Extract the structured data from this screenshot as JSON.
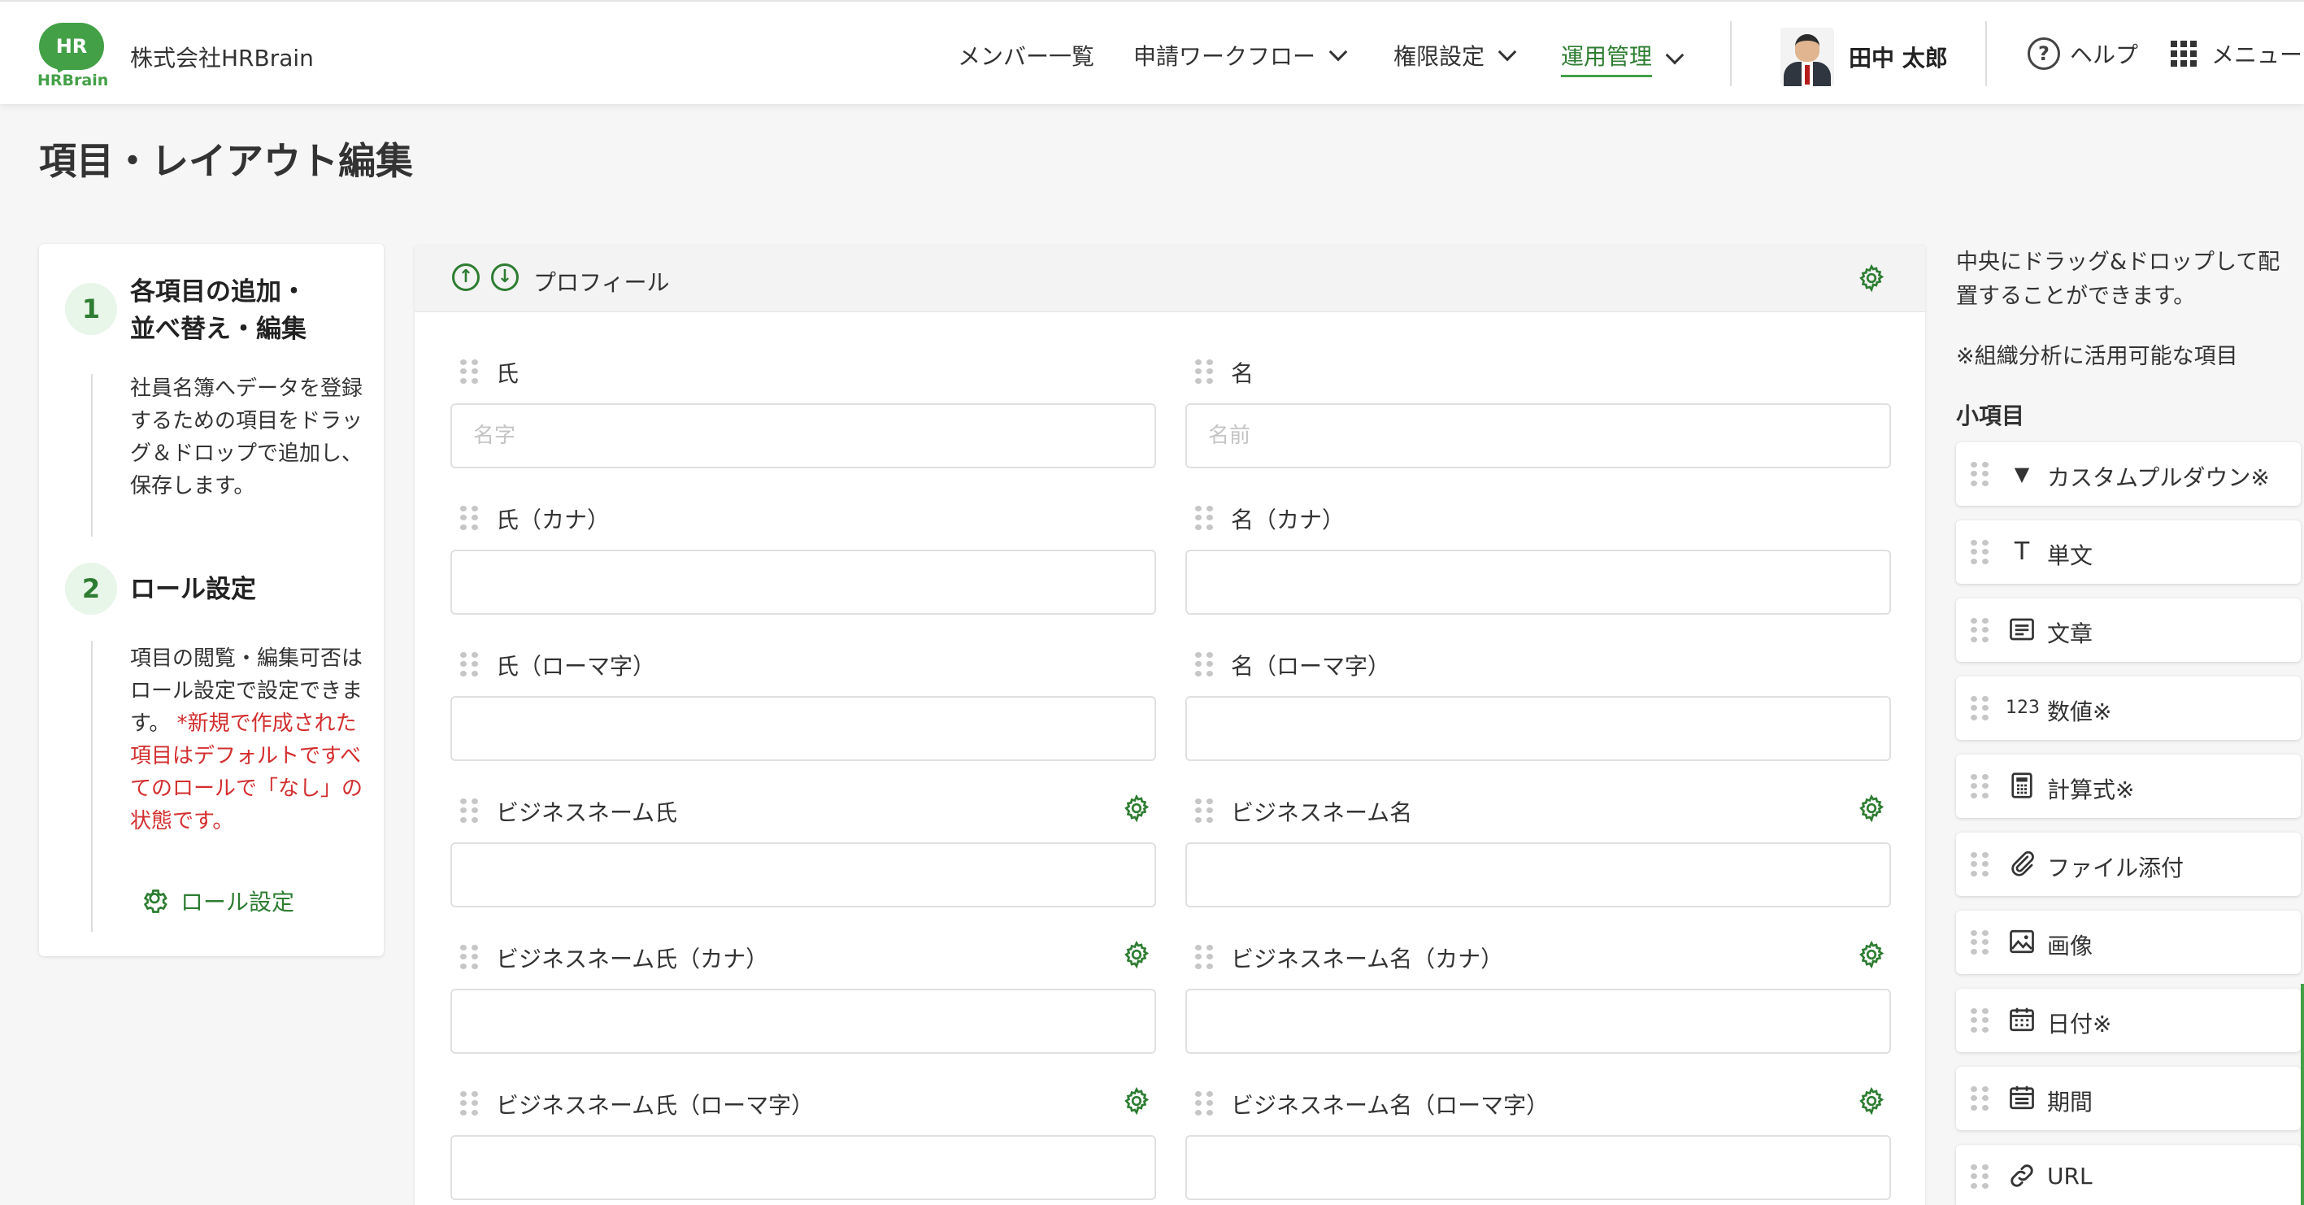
{
  "header": {
    "logo_text": "HR",
    "logo_brand": "HRBrain",
    "company": "株式会社HRBrain",
    "nav": [
      {
        "label": "メンバー一覧"
      },
      {
        "label": "申請ワークフロー"
      },
      {
        "label": "権限設定"
      },
      {
        "label": "運用管理"
      }
    ],
    "user_name": "田中 太郎",
    "help_label": "ヘルプ",
    "menu_label": "メニュー"
  },
  "page": {
    "title": "項目・レイアウト編集"
  },
  "steps": [
    {
      "num": "1",
      "title": "各項目の追加・並べ替え・編集",
      "text": "社員名簿へデータを登録するための項目をドラッグ＆ドロップで追加し、保存します。"
    },
    {
      "num": "2",
      "title": "ロール設定",
      "text": "項目の閲覧・編集可否はロール設定で設定できます。",
      "warning": "*新規で作成された項目はデフォルトですべてのロールで「なし」の状態です。",
      "link": "ロール設定"
    }
  ],
  "form": {
    "section_title": "プロフィール",
    "fields": [
      {
        "label": "氏",
        "placeholder": "名字"
      },
      {
        "label": "名",
        "placeholder": "名前"
      },
      {
        "label": "氏（カナ）",
        "placeholder": ""
      },
      {
        "label": "名（カナ）",
        "placeholder": ""
      },
      {
        "label": "氏（ローマ字）",
        "placeholder": ""
      },
      {
        "label": "名（ローマ字）",
        "placeholder": ""
      },
      {
        "label": "ビジネスネーム氏",
        "placeholder": ""
      },
      {
        "label": "ビジネスネーム名",
        "placeholder": ""
      },
      {
        "label": "ビジネスネーム氏（カナ）",
        "placeholder": ""
      },
      {
        "label": "ビジネスネーム名（カナ）",
        "placeholder": ""
      },
      {
        "label": "ビジネスネーム氏（ローマ字）",
        "placeholder": ""
      },
      {
        "label": "ビジネスネーム名（ローマ字）",
        "placeholder": ""
      }
    ]
  },
  "palette": {
    "intro": "中央にドラッグ&ドロップして配置することができます。",
    "note": "※組織分析に活用可能な項目",
    "subheading": "小項目",
    "items": [
      {
        "icon": "dropdown-triangle-icon",
        "glyph": "▼",
        "label": "カスタムプルダウン※"
      },
      {
        "icon": "text-t-icon",
        "glyph": "T",
        "label": "単文"
      },
      {
        "icon": "paragraph-icon",
        "glyph": "≣",
        "label": "文章"
      },
      {
        "icon": "number-123-icon",
        "glyph": "123",
        "label": "数値※"
      },
      {
        "icon": "calculator-icon",
        "glyph": "▦",
        "label": "計算式※"
      },
      {
        "icon": "paperclip-icon",
        "glyph": "⌇",
        "label": "ファイル添付"
      },
      {
        "icon": "image-icon",
        "glyph": "▨",
        "label": "画像"
      },
      {
        "icon": "calendar-icon",
        "glyph": "▦",
        "label": "日付※"
      },
      {
        "icon": "calendar-range-icon",
        "glyph": "▤",
        "label": "期間"
      },
      {
        "icon": "link-icon",
        "glyph": "⛓",
        "label": "URL"
      }
    ]
  },
  "colors": {
    "accent": "#43a047",
    "accent_dark": "#2e7d32",
    "warning": "#d32f2f"
  }
}
